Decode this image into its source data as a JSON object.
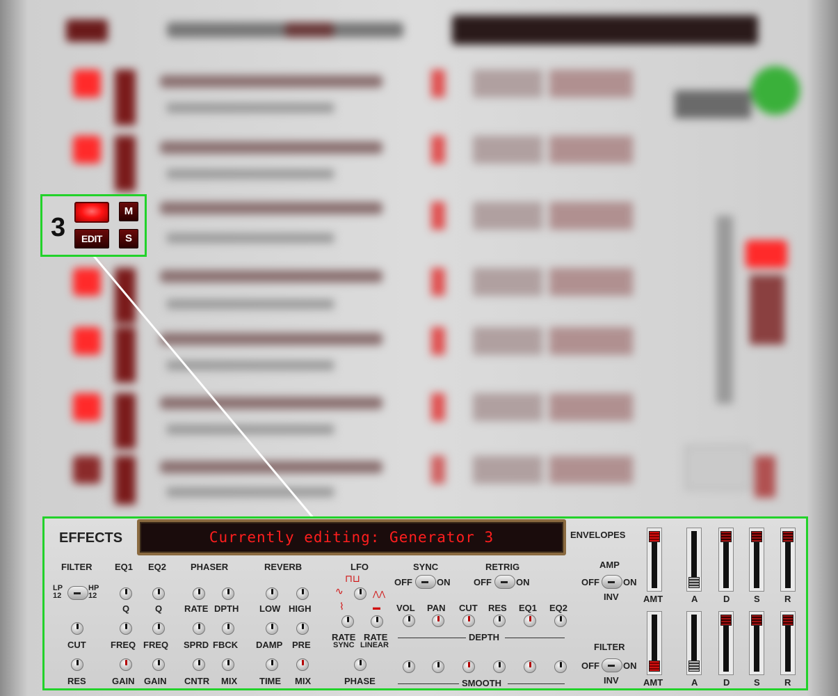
{
  "callout": {
    "channel_number": "3",
    "edit_label": "EDIT",
    "mute_label": "M",
    "solo_label": "S"
  },
  "effects": {
    "title": "EFFECTS",
    "display_text": "Currently editing: Generator 3",
    "filter": {
      "header": "FILTER",
      "lp_label": "LP\n12",
      "hp_label": "HP\n12",
      "cut_label": "CUT",
      "res_label": "RES"
    },
    "eq1": {
      "header": "EQ1",
      "q_label": "Q",
      "freq_label": "FREQ",
      "gain_label": "GAIN"
    },
    "eq2": {
      "header": "EQ2",
      "q_label": "Q",
      "freq_label": "FREQ",
      "gain_label": "GAIN"
    },
    "phaser": {
      "header": "PHASER",
      "rate_label": "RATE",
      "depth_label": "DPTH",
      "spread_label": "SPRD",
      "feedback_label": "FBCK",
      "center_label": "CNTR",
      "mix_label": "MIX"
    },
    "reverb": {
      "header": "REVERB",
      "low_label": "LOW",
      "high_label": "HIGH",
      "damp_label": "DAMP",
      "pre_label": "PRE",
      "time_label": "TIME",
      "mix_label": "MIX"
    },
    "lfo": {
      "header": "LFO",
      "rate_sync_label": "RATE",
      "rate_sync_sub": "SYNC",
      "rate_linear_label": "RATE",
      "rate_linear_sub": "LINEAR",
      "phase_label": "PHASE"
    },
    "sync": {
      "header": "SYNC",
      "off_label": "OFF",
      "on_label": "ON"
    },
    "retrig": {
      "header": "RETRIG",
      "off_label": "OFF",
      "on_label": "ON"
    },
    "mod_targets": [
      "VOL",
      "PAN",
      "CUT",
      "RES",
      "EQ1",
      "EQ2"
    ],
    "depth_label": "DEPTH",
    "smooth_label": "SMOOTH"
  },
  "envelopes": {
    "header": "ENVELOPES",
    "amp": {
      "header": "AMP",
      "off_label": "OFF",
      "on_label": "ON",
      "inv_label": "INV",
      "amt_label": "AMT"
    },
    "filter": {
      "header": "FILTER",
      "off_label": "OFF",
      "on_label": "ON",
      "inv_label": "INV",
      "amt_label": "AMT"
    },
    "adsr_labels": [
      "A",
      "D",
      "S",
      "R"
    ]
  }
}
